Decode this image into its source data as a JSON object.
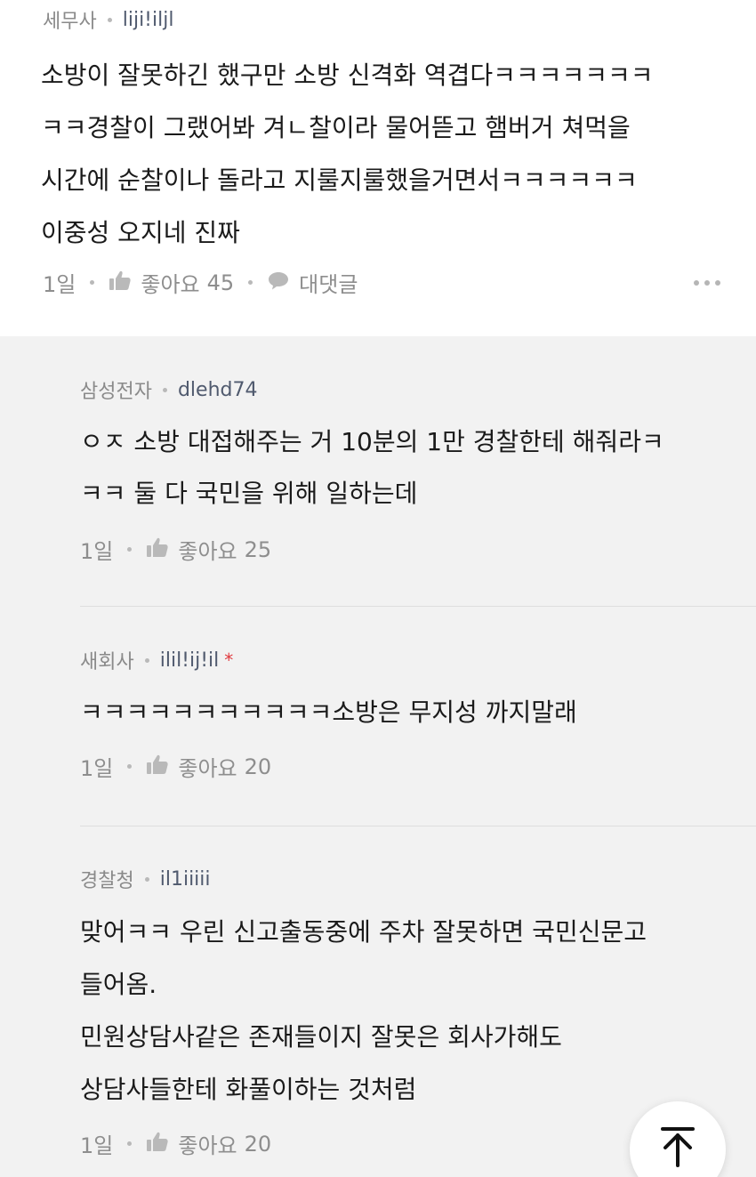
{
  "top_comment": {
    "company": "세무사",
    "nickname": "liji!iljl",
    "lines": [
      "소방이 잘못하긴 했구만 소방 신격화 역겹다ㅋㅋㅋㅋㅋㅋㅋ",
      "ㅋㅋ경찰이 그랬어봐 겨ㄴ찰이라 물어뜯고 햄버거 쳐먹을",
      "시간에 순찰이나 돌라고 지룰지룰했을거면서ㅋㅋㅋㅋㅋㅋ",
      "이중성 오지네 진짜"
    ],
    "time": "1일",
    "like_label": "좋아요",
    "like_count": "45",
    "reply_label": "대댓글"
  },
  "replies": [
    {
      "company": "삼성전자",
      "nickname": "dlehd74",
      "lines": [
        "ㅇㅈ 소방 대접해주는 거 10분의 1만 경찰한테 해줘라ㅋ",
        "ㅋㅋ 둘 다 국민을 위해 일하는데"
      ],
      "time": "1일",
      "like_label": "좋아요",
      "like_count": "25"
    },
    {
      "company": "새회사",
      "nickname": "ilil!ij!il",
      "flag": "*",
      "lines": [
        "ㅋㅋㅋㅋㅋㅋㅋㅋㅋㅋㅋ소방은 무지성 까지말래"
      ],
      "time": "1일",
      "like_label": "좋아요",
      "like_count": "20"
    },
    {
      "company": "경찰청",
      "nickname": "il1iiiii",
      "lines": [
        "맞어ㅋㅋ 우린 신고출동중에 주차 잘못하면 국민신문고",
        "들어옴.",
        "민원상담사같은 존재들이지 잘못은 회사가해도",
        "상담사들한테 화풀이하는 것처럼"
      ],
      "time": "1일",
      "like_label": "좋아요",
      "like_count": "20"
    }
  ],
  "icons": {
    "like": "thumbs-up-icon",
    "reply": "speech-bubble-icon",
    "more": "more-dots-icon",
    "scroll_top": "arrow-up-to-top-icon"
  },
  "colors": {
    "meta_text": "#8a8a8a",
    "nickname": "#505a6e",
    "flag": "#e0393e",
    "reply_bg": "#f2f2f2"
  }
}
